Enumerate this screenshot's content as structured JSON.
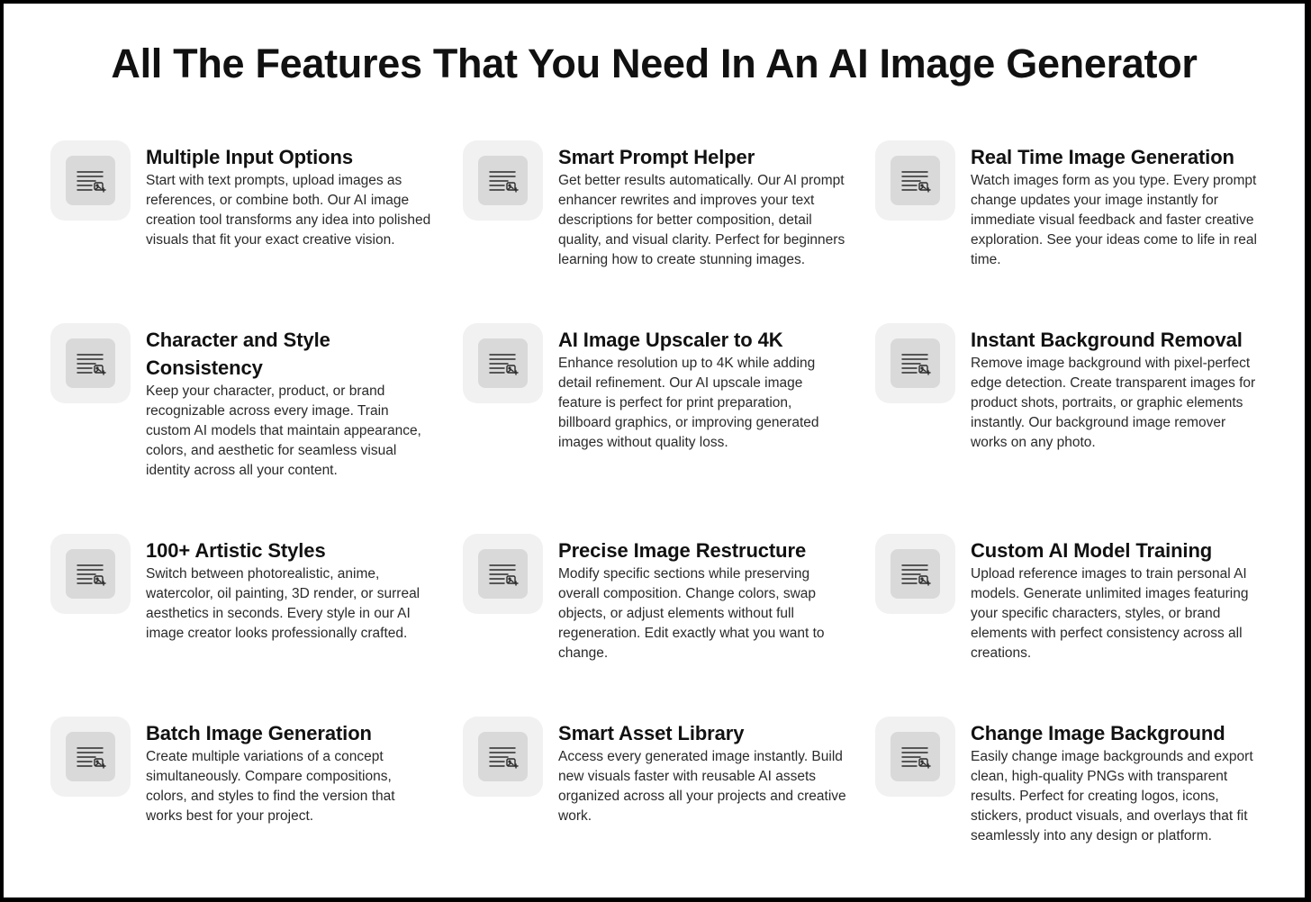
{
  "page": {
    "title": "All The Features That You Need In An AI Image Generator"
  },
  "icon": "text-image-icon",
  "features": [
    {
      "title": "Multiple Input Options",
      "description": "Start with text prompts, upload images as references, or combine both. Our AI image creation tool transforms any idea into polished visuals that fit your exact creative vision."
    },
    {
      "title": "Smart Prompt Helper",
      "description": "Get better results automatically. Our AI prompt enhancer rewrites and improves your text descriptions for better composition, detail quality, and visual clarity. Perfect for beginners learning how to create stunning images."
    },
    {
      "title": "Real Time Image Generation",
      "description": "Watch images form as you type. Every prompt change updates your image instantly for immediate visual feedback and faster creative exploration. See your ideas come to life in real time."
    },
    {
      "title": "Character and Style Consistency",
      "description": "Keep your character, product, or brand recognizable across every image. Train custom AI models that maintain appearance, colors, and aesthetic for seamless visual identity across all your content."
    },
    {
      "title": "AI Image Upscaler to 4K",
      "description": "Enhance resolution up to 4K while adding detail refinement. Our AI upscale image feature is perfect for print preparation, billboard graphics, or improving generated images without quality loss."
    },
    {
      "title": "Instant Background Removal",
      "description": "Remove image background with pixel-perfect edge detection. Create transparent images for product shots, portraits, or graphic elements instantly. Our background image remover works on any photo."
    },
    {
      "title": "100+ Artistic Styles",
      "description": "Switch between photorealistic, anime, watercolor, oil painting, 3D render, or surreal aesthetics in seconds. Every style in our AI image creator looks professionally crafted."
    },
    {
      "title": "Precise Image Restructure",
      "description": "Modify specific sections while preserving overall composition. Change colors, swap objects, or adjust elements without full regeneration. Edit exactly what you want to change."
    },
    {
      "title": "Custom AI Model Training",
      "description": "Upload reference images to train personal AI models. Generate unlimited images featuring your specific characters, styles, or brand elements with perfect consistency across all creations."
    },
    {
      "title": "Batch Image Generation",
      "description": "Create multiple variations of a concept simultaneously. Compare compositions, colors, and styles to find the version that works best for your project."
    },
    {
      "title": "Smart Asset Library",
      "description": "Access every generated image instantly. Build new visuals faster with reusable AI assets organized across all your projects and creative work."
    },
    {
      "title": "Change Image Background",
      "description": "Easily change image backgrounds and export clean, high-quality PNGs with transparent results. Perfect for creating logos, icons, stickers, product visuals, and overlays that fit seamlessly into any design or platform."
    }
  ]
}
